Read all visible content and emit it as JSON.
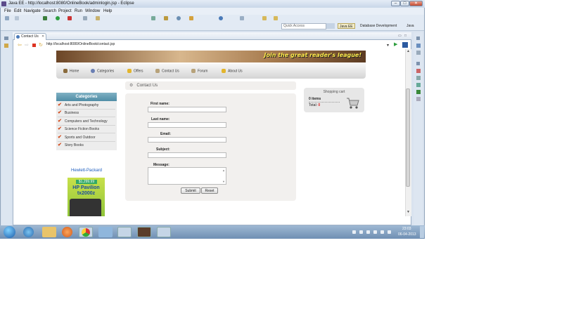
{
  "window": {
    "title": "Java EE - http://localhost:8080/OnlineBook/adminlogin.jsp - Eclipse"
  },
  "menubar": [
    "File",
    "Edit",
    "Navigate",
    "Search",
    "Project",
    "Run",
    "Window",
    "Help"
  ],
  "perspective_bar": {
    "quick_access_placeholder": "Quick Access",
    "perspectives": [
      "Java EE",
      "Database Development",
      "Java"
    ]
  },
  "editor": {
    "tab_label": "Contact Us",
    "url": "http://localhost:8080/OnlineBook/contact.jsp"
  },
  "site": {
    "banner_text": "Join the great reader's league!",
    "nav": [
      "Home",
      "Categories",
      "Offers",
      "Contact Us",
      "Forum",
      "About Us"
    ],
    "categories_title": "Categories",
    "categories": [
      "Arts and Photography",
      "Business",
      "Computers and Technology",
      "Science Fiction Books",
      "Sports and Outdoor",
      "Story Books"
    ],
    "ad": {
      "title": "Hewlett-Packard",
      "price": "$1,299.99",
      "model_line1": "HP Pavilion",
      "model_line2": "tx2000z"
    },
    "contact_header": "Contact Us",
    "form": {
      "first_name_label": "First name:",
      "last_name_label": "Last name:",
      "email_label": "Email:",
      "subject_label": "Subject:",
      "message_label": "Message:",
      "submit_label": "Submit",
      "reset_label": "Reset"
    },
    "cart": {
      "title": "Shopping cart",
      "items": "0 items",
      "total_label": "Total:",
      "total_value": "0"
    }
  },
  "taskbar": {
    "time": "23:03",
    "date": "06-04-2013"
  },
  "colors": {
    "accent": "#4f8da6",
    "banner_text": "#ffe94a",
    "link": "#1a5bbf",
    "check": "#d24a1a"
  }
}
